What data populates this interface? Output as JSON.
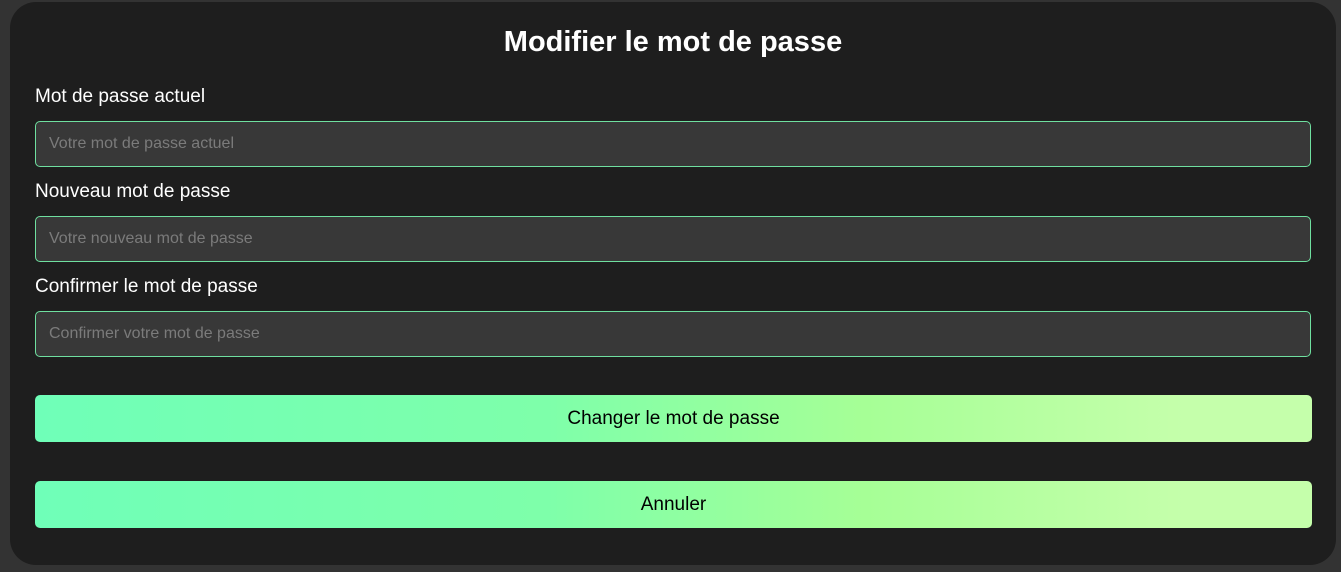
{
  "title": "Modifier le mot de passe",
  "fields": [
    {
      "label": "Mot de passe actuel",
      "placeholder": "Votre mot de passe actuel",
      "value": ""
    },
    {
      "label": "Nouveau mot de passe",
      "placeholder": "Votre nouveau mot de passe",
      "value": ""
    },
    {
      "label": "Confirmer le mot de passe",
      "placeholder": "Confirmer votre mot de passe",
      "value": ""
    }
  ],
  "buttons": {
    "submit": "Changer le mot de passe",
    "cancel": "Annuler"
  },
  "colors": {
    "gradient_start": "#6fffb8",
    "gradient_mid": "#a6ff96",
    "gradient_end": "#c5ffab",
    "input_border": "#6fe0a0"
  }
}
